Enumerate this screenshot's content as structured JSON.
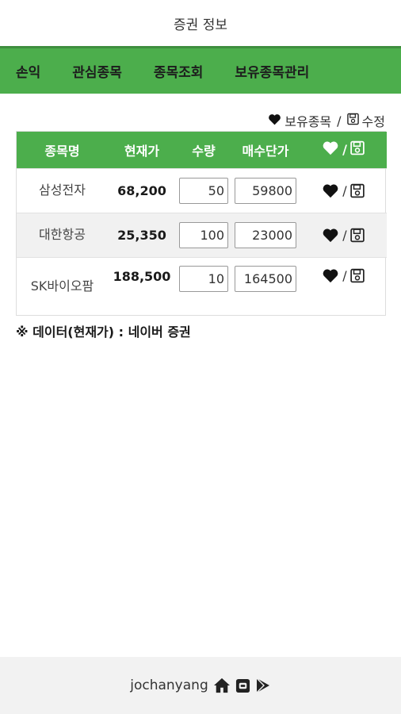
{
  "page": {
    "title": "증권 정보"
  },
  "nav": {
    "items": [
      {
        "label": "손익"
      },
      {
        "label": "관심종목"
      },
      {
        "label": "종목조회"
      },
      {
        "label": "보유종목관리"
      }
    ]
  },
  "legend": {
    "holding_label": "보유종목",
    "separator": "/",
    "edit_label": "수정"
  },
  "table": {
    "headers": [
      "종목명",
      "현재가",
      "수량",
      "매수단가"
    ],
    "header_action_separator": "/",
    "rows": [
      {
        "name": "삼성전자",
        "price": "68,200",
        "qty": "50",
        "buy_price": "59800",
        "sep": "/"
      },
      {
        "name": "대한항공",
        "price": "25,350",
        "qty": "100",
        "buy_price": "23000",
        "sep": "/"
      },
      {
        "name": "SK바이오팜",
        "price": "188,500",
        "qty": "10",
        "buy_price": "164500",
        "sep": "/"
      }
    ]
  },
  "note": {
    "text": "※ 데이터(현재가) : 네이버 증권"
  },
  "footer": {
    "author": "jochanyang"
  },
  "colors": {
    "accent": "#4cae4c",
    "nav_border": "#3f8e3f",
    "footer_bg": "#f2f2f2"
  },
  "icons": [
    "heart-icon",
    "save-icon",
    "home-icon",
    "blog-icon",
    "play-store-icon"
  ]
}
